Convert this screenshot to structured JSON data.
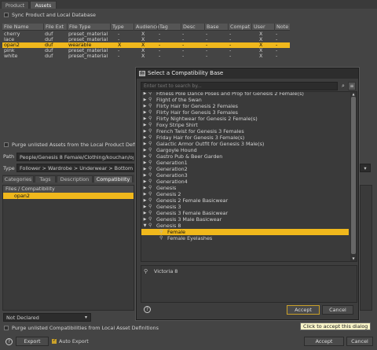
{
  "tabs": {
    "product": "Product",
    "assets": "Assets"
  },
  "sync_label": "Sync Product and Local Database",
  "columns": [
    "File Name",
    "File Ext",
    "File Type",
    "Type",
    "Audience",
    "Tag",
    "Desc",
    "Base",
    "Compat",
    "User",
    "Note"
  ],
  "rows": [
    {
      "name": "cherry",
      "ext": "duf",
      "ftype": "preset_material",
      "type": "-",
      "aud": "X",
      "tag": "-",
      "desc": "-",
      "base": "-",
      "compat": "-",
      "user": "X",
      "note": "-"
    },
    {
      "name": "lace",
      "ext": "duf",
      "ftype": "preset_material",
      "type": "-",
      "aud": "X",
      "tag": "-",
      "desc": "-",
      "base": "-",
      "compat": "-",
      "user": "X",
      "note": "-"
    },
    {
      "name": "opan2",
      "ext": "duf",
      "ftype": "wearable",
      "type": "X",
      "aud": "X",
      "tag": "-",
      "desc": "-",
      "base": "-",
      "compat": "-",
      "user": "X",
      "note": "-"
    },
    {
      "name": "pink",
      "ext": "duf",
      "ftype": "preset_material",
      "type": "-",
      "aud": "X",
      "tag": "-",
      "desc": "-",
      "base": "-",
      "compat": "-",
      "user": "X",
      "note": "-"
    },
    {
      "name": "white",
      "ext": "duf",
      "ftype": "preset_material",
      "type": "-",
      "aud": "X",
      "tag": "-",
      "desc": "-",
      "base": "-",
      "compat": "-",
      "user": "X",
      "note": "-"
    }
  ],
  "purge_unlisted_label": "Purge unlisted Assets from the Local Product Definition",
  "path_label": "Path",
  "path_value": "People/Genesis 8 Female/Clothing/kouchan/opan2",
  "type_label": "Type",
  "type_value": "Follower > Wardrobe > Underwear > Bottom",
  "subtabs": [
    "Categories",
    "Tags",
    "Description",
    "Compatibility"
  ],
  "files_header": "Files / Compatibility",
  "files_item": "opan2",
  "not_declared": "Not Declared",
  "purge_compat_label": "Purge unlisted Compatibilities from Local Asset Definitions",
  "export_label": "Export",
  "auto_export_label": "Auto Export",
  "accept_label": "Accept",
  "cancel_label": "Cancel",
  "dialog": {
    "title": "Select a Compatibility Base",
    "search_placeholder": "Enter text to search by...",
    "items": [
      {
        "label": "Fitness Pole Dance Poses and Prop for Genesis 2 Female(s)",
        "exp": "▶"
      },
      {
        "label": "Flight of the Swan",
        "exp": "▶"
      },
      {
        "label": "Flirty Hair for Genesis 2 Females",
        "exp": "▶"
      },
      {
        "label": "Flirty Hair for Genesis 3 Females",
        "exp": "▶"
      },
      {
        "label": "Flirty Nightwear for Genesis 2 Female(s)",
        "exp": "▶"
      },
      {
        "label": "Foxy Stripe Shirt",
        "exp": "▶"
      },
      {
        "label": "French Twist for Genesis 3 Females",
        "exp": "▶"
      },
      {
        "label": "Friday Hair for Genesis 3 Female(s)",
        "exp": "▶"
      },
      {
        "label": "Galactic Armor Outfit for Genesis 3 Male(s)",
        "exp": "▶"
      },
      {
        "label": "Gargoyle Hound",
        "exp": "▶"
      },
      {
        "label": "Gastro Pub & Beer Garden",
        "exp": "▶"
      },
      {
        "label": "Generation1",
        "exp": "▶"
      },
      {
        "label": "Generation2",
        "exp": "▶"
      },
      {
        "label": "Generation3",
        "exp": "▶"
      },
      {
        "label": "Generation4",
        "exp": "▶"
      },
      {
        "label": "Genesis",
        "exp": "▶"
      },
      {
        "label": "Genesis 2",
        "exp": "▶"
      },
      {
        "label": "Genesis 2 Female Basicwear",
        "exp": "▶"
      },
      {
        "label": "Genesis 3",
        "exp": "▶"
      },
      {
        "label": "Genesis 3 Female Basicwear",
        "exp": "▶"
      },
      {
        "label": "Genesis 3 Male Basicwear",
        "exp": "▶"
      },
      {
        "label": "Genesis 8",
        "exp": "▼"
      },
      {
        "label": "Female",
        "exp": ""
      },
      {
        "label": "Female Eyelashes",
        "exp": ""
      }
    ],
    "selected_label": "Victoria 8",
    "help": "?",
    "accept": "Accept",
    "cancel": "Cancel",
    "tooltip": "Click to accept this dialog"
  },
  "colors": {
    "accent": "#f0b81c",
    "panel": "#444444",
    "dialog": "#3d3d3d"
  }
}
